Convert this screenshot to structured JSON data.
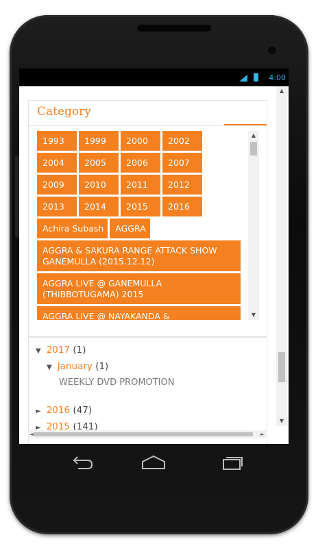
{
  "status_bar": {
    "time": "4:00",
    "signal_icon": "signal-icon",
    "battery_icon": "battery-icon",
    "accent_color": "#33b5e5"
  },
  "category": {
    "title": "Category",
    "accent_color": "#f4801f",
    "labels": [
      "1993",
      "1999",
      "2000",
      "2002",
      "2004",
      "2005",
      "2006",
      "2007",
      "2009",
      "2010",
      "2011",
      "2012",
      "2013",
      "2014",
      "2015",
      "2016",
      "Achira Subash",
      "AGGRA",
      "AGGRA & SAKURA RANGE ATTACK SHOW GANEMULLA (2015.12.12)",
      "AGGRA LIVE @ GANEMULLA (THIBBOTUGAMA) 2015",
      "AGGRA LIVE @ NAYAKANDA &"
    ]
  },
  "archive": {
    "year_2017": {
      "label": "2017",
      "count": "(1)"
    },
    "month_january": {
      "label": "January",
      "count": "(1)"
    },
    "post": "WEEKLY DVD PROMOTION",
    "year_2016": {
      "label": "2016",
      "count": "(47)"
    },
    "year_2015": {
      "label": "2015",
      "count": "(141)"
    }
  },
  "nav": {
    "back_icon": "back-icon",
    "home_icon": "home-icon",
    "recent_icon": "recent-apps-icon"
  }
}
